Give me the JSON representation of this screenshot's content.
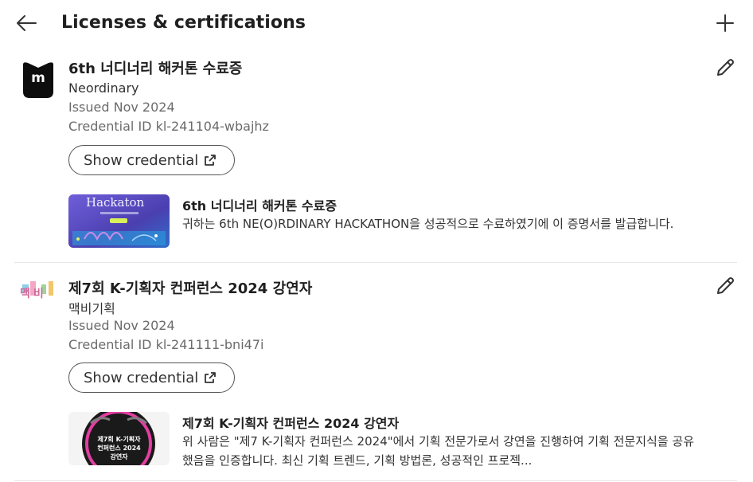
{
  "header": {
    "title": "Licenses & certifications",
    "back_icon": "arrow-left-icon",
    "add_icon": "plus-icon"
  },
  "entries": [
    {
      "title": "6th 너디너리 해커톤 수료증",
      "issuer": "Neordinary",
      "issued": "Issued Nov 2024",
      "credential_id": "Credential ID kl-241104-wbajhz",
      "show_credential_label": "Show credential",
      "media": {
        "title": "6th 너디너리 해커톤 수료증",
        "description": "귀하는 6th NE(O)RDINARY HACKATHON을 성공적으로 수료하였기에 이 증명서를 발급합니다.",
        "thumb_text": "Hackaton"
      },
      "logo_letter": "m"
    },
    {
      "title": "제7회 K-기획자 컨퍼런스 2024 강연자",
      "issuer": "맥비기획",
      "issued": "Issued Nov 2024",
      "credential_id": "Credential ID kl-241111-bni47i",
      "show_credential_label": "Show credential",
      "media": {
        "title": "제7회 K-기획자 컨퍼런스 2024 강연자",
        "description": "위 사람은 \"제7 K-기획자 컨퍼런스 2024\"에서 기획 전문가로서 강연을 진행하여 기획 전문지식을 공유했음을 인증합니다. 최신 기획 트렌드, 기획 방법론, 성공적인 프로젝...",
        "thumb_line1": "제7회 K-기획자",
        "thumb_line2": "컨퍼런스 2024",
        "thumb_line3": "강연자"
      },
      "logo_text": "맥비"
    }
  ],
  "colors": {
    "text_primary": "#1f1f1f",
    "text_secondary": "#6b6b6b",
    "divider": "#e6e6e6",
    "border": "#555555"
  }
}
